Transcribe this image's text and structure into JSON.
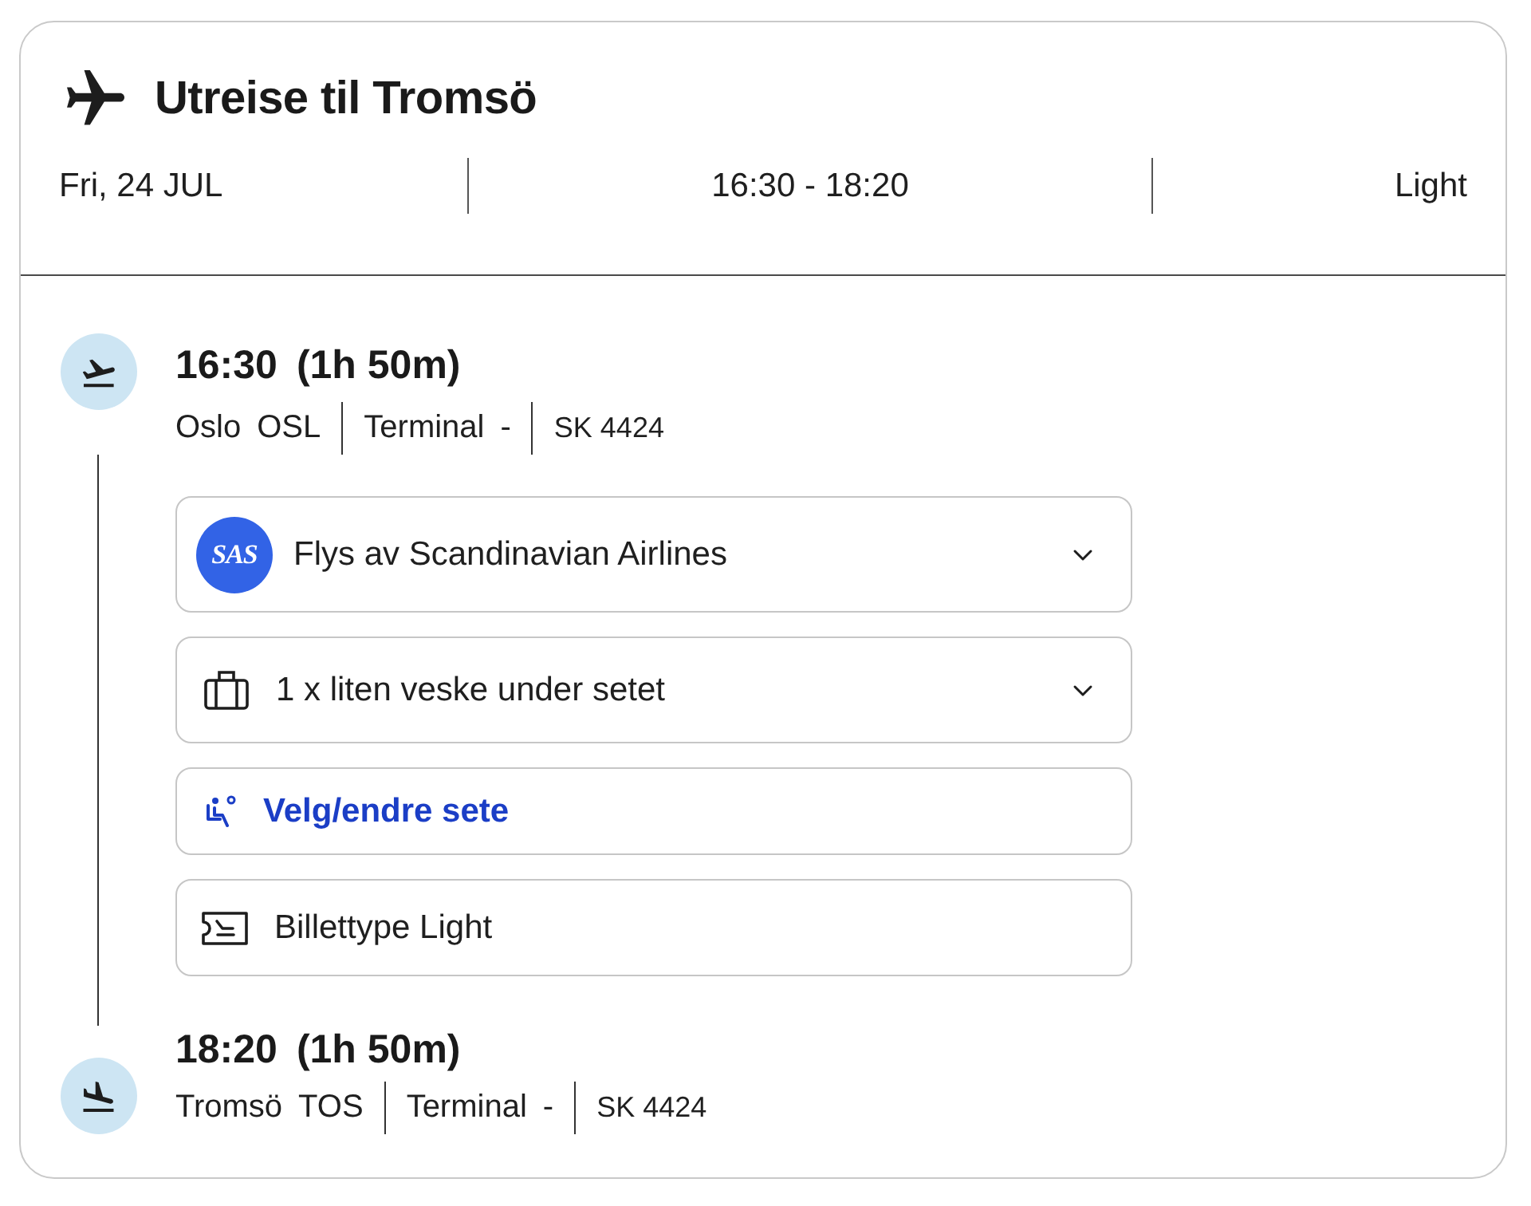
{
  "header": {
    "title": "Utreise til Tromsö",
    "date": "Fri, 24 JUL",
    "time_range": "16:30 - 18:20",
    "fare": "Light"
  },
  "departure": {
    "time": "16:30",
    "duration": "(1h 50m)",
    "city": "Oslo",
    "airport": "OSL",
    "terminal_label": "Terminal",
    "terminal": "-",
    "flight": "SK 4424"
  },
  "details": [
    {
      "kind": "airline",
      "logo": "SAS",
      "text": "Flys av Scandinavian Airlines",
      "expanded": false
    },
    {
      "kind": "baggage",
      "text": "1 x liten veske under setet",
      "expanded": false
    },
    {
      "kind": "seat",
      "text": "Velg/endre sete"
    },
    {
      "kind": "ticket",
      "text": "Billettype Light"
    }
  ],
  "arrival": {
    "time": "18:20",
    "duration": "(1h 50m)",
    "city": "Tromsö",
    "airport": "TOS",
    "terminal_label": "Terminal",
    "terminal": "-",
    "flight": "SK 4424"
  }
}
